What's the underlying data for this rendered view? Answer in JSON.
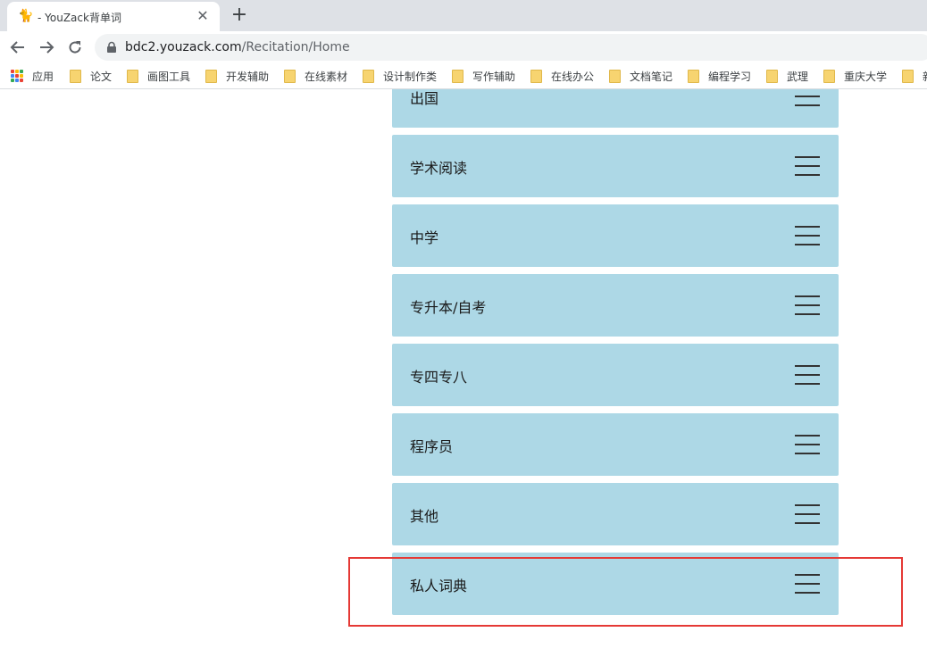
{
  "browser": {
    "tab": {
      "title": "- YouZack背单词",
      "favicon": "cat-icon",
      "close_label": "✕"
    },
    "new_tab_label": "+",
    "address": {
      "host": "bdc2.youzack.com",
      "path": "/Recitation/Home"
    },
    "bookmarks": [
      {
        "label": "应用",
        "icon": "apps-icon"
      },
      {
        "label": "论文",
        "icon": "folder-icon"
      },
      {
        "label": "画图工具",
        "icon": "folder-icon"
      },
      {
        "label": "开发辅助",
        "icon": "folder-icon"
      },
      {
        "label": "在线素材",
        "icon": "folder-icon"
      },
      {
        "label": "设计制作类",
        "icon": "folder-icon"
      },
      {
        "label": "写作辅助",
        "icon": "folder-icon"
      },
      {
        "label": "在线办公",
        "icon": "folder-icon"
      },
      {
        "label": "文档笔记",
        "icon": "folder-icon"
      },
      {
        "label": "编程学习",
        "icon": "folder-icon"
      },
      {
        "label": "武理",
        "icon": "folder-icon"
      },
      {
        "label": "重庆大学",
        "icon": "folder-icon"
      },
      {
        "label": "新",
        "icon": "folder-icon"
      }
    ]
  },
  "categories": [
    {
      "label": "出国"
    },
    {
      "label": "学术阅读"
    },
    {
      "label": "中学"
    },
    {
      "label": "专升本/自考"
    },
    {
      "label": "专四专八"
    },
    {
      "label": "程序员"
    },
    {
      "label": "其他"
    },
    {
      "label": "私人词典"
    }
  ],
  "colors": {
    "item_background": "#add8e6",
    "highlight_border": "#e53935",
    "tabstrip": "#dee1e6"
  }
}
